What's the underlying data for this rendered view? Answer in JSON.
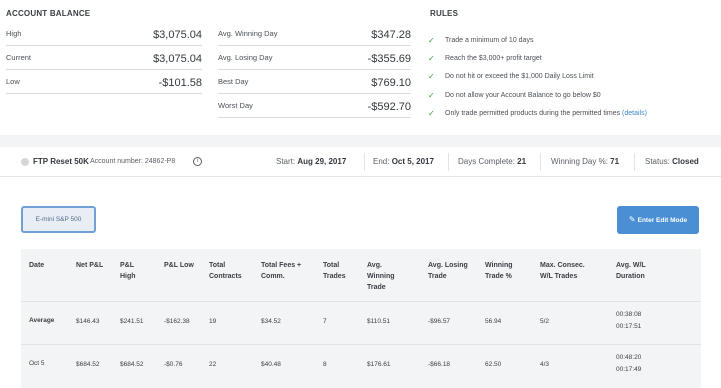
{
  "balance": {
    "title": "ACCOUNT BALANCE",
    "high_label": "High",
    "high_value": "$3,075.04",
    "current_label": "Current",
    "current_value": "$3,075.04",
    "low_label": "Low",
    "low_value": "-$101.58"
  },
  "days": {
    "avg_win_label": "Avg. Winning Day",
    "avg_win_value": "$347.28",
    "avg_lose_label": "Avg. Losing Day",
    "avg_lose_value": "-$355.69",
    "best_label": "Best Day",
    "best_value": "$769.10",
    "worst_label": "Worst Day",
    "worst_value": "-$592.70"
  },
  "rules": {
    "title": "RULES",
    "items": [
      "Trade a minimum of 10 days",
      "Reach the $3,000+ profit target",
      "Do not hit or exceed the $1,000 Daily Loss Limit",
      "Do not allow your Account Balance to go below $0",
      "Only trade permitted products during the permitted times"
    ],
    "details_link": "(details)",
    "check_icon": "check-icon",
    "check_color": "#3a9d3a"
  },
  "account": {
    "name": "FTP Reset 50K",
    "number_label": "Account number:",
    "number": "24862-P8",
    "start_label": "Start:",
    "start": "Aug 29, 2017",
    "end_label": "End:",
    "end": "Oct 5, 2017",
    "days_label": "Days Complete:",
    "days": "21",
    "win_label": "Winning Day %:",
    "win": "71",
    "status_label": "Status:",
    "status": "Closed"
  },
  "buttons": {
    "product_tab": "E-mini S&P 500",
    "edit_mode": "Enter Edit Mode",
    "accent_color": "#4a8fd4"
  },
  "table": {
    "headers": [
      "Date",
      "Net P&L",
      "P&L High",
      "P&L Low",
      "Total Contracts",
      "Total Fees + Comm.",
      "Total Trades",
      "Avg. Winning Trade",
      "Avg. Losing Trade",
      "Winning Trade %",
      "Max. Consec. W/L Trades",
      "Avg. W/L Duration"
    ],
    "rows": [
      [
        "Average",
        "$146.43",
        "$241.51",
        "-$162.38",
        "19",
        "$34.52",
        "7",
        "$110.51",
        "-$96.57",
        "56.94",
        "5/2",
        "00:38:08",
        "00:17:51"
      ],
      [
        "Oct 5",
        "$684.52",
        "$684.52",
        "-$0.76",
        "22",
        "$40.48",
        "8",
        "$176.61",
        "-$66.18",
        "62.50",
        "4/3",
        "00:48:20",
        "00:17:49"
      ]
    ]
  }
}
